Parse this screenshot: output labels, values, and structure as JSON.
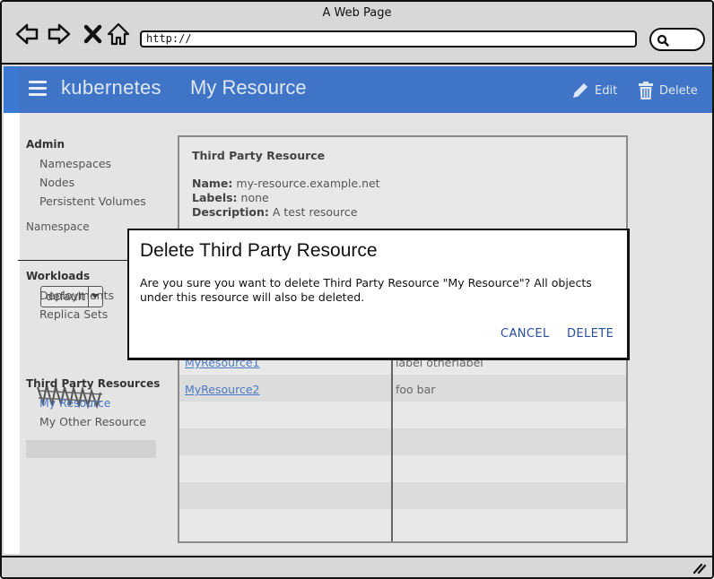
{
  "window": {
    "title": "A Web Page"
  },
  "browser": {
    "url": "http://"
  },
  "app": {
    "brand": "kubernetes",
    "resource_title": "My Resource",
    "actions": {
      "edit": "Edit",
      "delete": "Delete"
    }
  },
  "sidebar": {
    "admin_heading": "Admin",
    "admin_items": [
      "Namespaces",
      "Nodes",
      "Persistent Volumes"
    ],
    "namespace_label": "Namespace",
    "namespace_value": "default",
    "workloads_heading": "Workloads",
    "workload_items": [
      "Deployments",
      "Replica Sets"
    ],
    "tpr_heading": "Third Party Resources",
    "tpr_items": [
      "My Resource",
      "My Other Resource"
    ]
  },
  "card": {
    "title": "Third Party Resource",
    "name_label": "Name:",
    "name_value": "my-resource.example.net",
    "labels_label": "Labels:",
    "labels_value": "none",
    "description_label": "Description:",
    "description_value": "A test resource",
    "rows": [
      {
        "name": "MyResource1",
        "labels": "label otherlabel"
      },
      {
        "name": "MyResource2",
        "labels": "foo bar"
      }
    ]
  },
  "dialog": {
    "title": "Delete Third Party Resource",
    "message": "Are you sure you want to delete Third Party Resource \"My Resource\"? All objects under this resource will also be deleted.",
    "cancel": "CANCEL",
    "delete": "DELETE"
  },
  "colors": {
    "appbar": "#3f74c6",
    "accent_strip": "#3a78d4",
    "link": "#4b79c8",
    "dialog_button": "#2a4e9a"
  },
  "icons": [
    "back-icon",
    "forward-icon",
    "close-icon",
    "home-icon",
    "search-icon",
    "menu-icon",
    "pencil-icon",
    "trash-icon",
    "resize-grip-icon"
  ]
}
